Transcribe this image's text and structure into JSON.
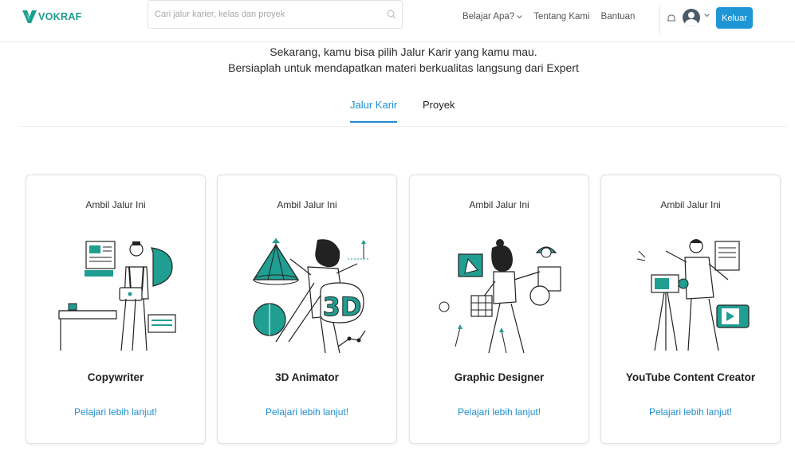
{
  "header": {
    "logo_text": "VOKRAF",
    "search": {
      "placeholder": "Cari jalur karier, kelas dan proyek",
      "value": ""
    },
    "nav": [
      {
        "label": "Belajar Apa?",
        "has_dropdown": true
      },
      {
        "label": "Tentang Kami",
        "has_dropdown": false
      },
      {
        "label": "Bantuan",
        "has_dropdown": false
      }
    ],
    "logout_label": "Keluar"
  },
  "intro": {
    "line1": "Sekarang, kamu bisa pilih Jalur Karir yang kamu mau.",
    "line2": "Bersiaplah untuk mendapatkan materi berkualitas langsung dari Expert"
  },
  "tabs": [
    {
      "label": "Jalur Karir",
      "active": true
    },
    {
      "label": "Proyek",
      "active": false
    }
  ],
  "cards": [
    {
      "top_label": "Ambil Jalur Ini",
      "title": "Copywriter",
      "link": "Pelajari lebih lanjut!"
    },
    {
      "top_label": "Ambil Jalur Ini",
      "title": "3D Animator",
      "illustration_text": "3D",
      "link": "Pelajari lebih lanjut!"
    },
    {
      "top_label": "Ambil Jalur Ini",
      "title": "Graphic Designer",
      "link": "Pelajari lebih lanjut!"
    },
    {
      "top_label": "Ambil Jalur Ini",
      "title": "YouTube Content Creator",
      "link": "Pelajari lebih lanjut!"
    }
  ],
  "colors": {
    "brand": "#1b9c8e",
    "accent": "#1e8ed0",
    "illustration_teal": "#1f9e91",
    "logout_bg": "#1e96d6"
  },
  "icons": [
    "vokraf-logo-icon",
    "search-icon",
    "chevron-down-icon",
    "bell-icon",
    "avatar-icon"
  ]
}
